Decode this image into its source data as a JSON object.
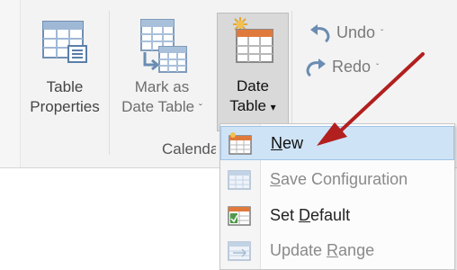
{
  "ribbon": {
    "table_properties": {
      "line1": "Table",
      "line2": "Properties"
    },
    "mark_as_date_table": {
      "line1": "Mark as",
      "line2": "Date Table",
      "caret": "ˇ"
    },
    "date_table": {
      "line1": "Date",
      "line2": "Table",
      "caret": "▾"
    },
    "undo": {
      "label": "Undo",
      "caret": "ˇ"
    },
    "redo": {
      "label": "Redo",
      "caret": "ˇ"
    },
    "group_label": "Calenda"
  },
  "menu": {
    "items": [
      {
        "pre": "",
        "mnemonic": "N",
        "post": "ew",
        "state": "active",
        "icon": "new-calendar-icon"
      },
      {
        "pre": "",
        "mnemonic": "S",
        "post": "ave Configuration",
        "state": "disabled",
        "icon": "save-config-icon"
      },
      {
        "pre": "Set ",
        "mnemonic": "D",
        "post": "efault",
        "state": "enabled",
        "icon": "set-default-icon"
      },
      {
        "pre": "Update ",
        "mnemonic": "R",
        "post": "ange",
        "state": "disabled",
        "icon": "update-range-icon"
      }
    ]
  },
  "colors": {
    "annotation_arrow": "#b21f1f",
    "menu_highlight": "#cfe3f6",
    "date_table_pressed": "#d9d9d9"
  }
}
